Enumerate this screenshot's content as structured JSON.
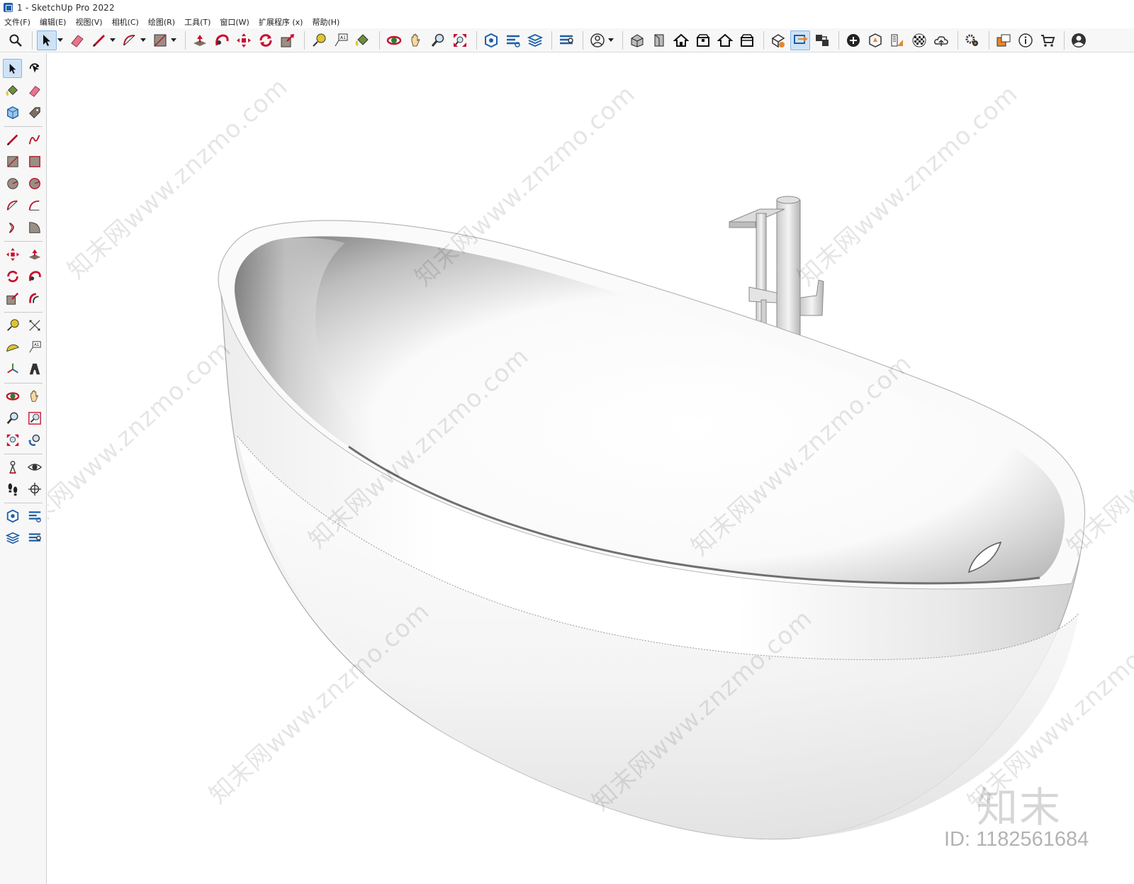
{
  "window": {
    "title": "1 - SketchUp Pro 2022"
  },
  "menu": {
    "items": [
      "文件(F)",
      "编辑(E)",
      "视图(V)",
      "相机(C)",
      "绘图(R)",
      "工具(T)",
      "窗口(W)",
      "扩展程序 (x)",
      "帮助(H)"
    ]
  },
  "toolbar": {
    "icons": [
      "search-icon",
      "select-icon",
      "eraser-icon",
      "pencil-icon",
      "arc-icon",
      "rectangle-icon",
      "push-pull-icon",
      "follow-me-icon",
      "move-icon",
      "rotate-icon",
      "scale-icon",
      "tape-measure-icon",
      "text-icon",
      "paint-bucket-icon",
      "orbit-icon",
      "pan-icon",
      "zoom-icon",
      "zoom-extents-icon",
      "warehouse-icon",
      "extension-warehouse-icon",
      "layout-icon",
      "style-builder-icon",
      "user-icon",
      "iso-view-icon",
      "top-view-icon",
      "front-view-icon",
      "right-view-icon",
      "back-view-icon",
      "left-view-icon",
      "section-plane-icon",
      "section-display-icon",
      "component-icon",
      "add-location-icon",
      "sandbox-icon",
      "photo-texture-icon",
      "preview-icon",
      "cloud-icon",
      "settings-icon",
      "outliner-icon",
      "info-icon",
      "cart-icon",
      "account-icon"
    ],
    "accent": "#1d5fa8",
    "active_tool": "select-icon"
  },
  "left_toolbar": {
    "rows": [
      [
        "select-icon",
        "orbit-icon"
      ],
      [
        "paint-bucket-icon",
        "eraser-icon"
      ],
      [
        "component-icon",
        "tag-icon"
      ],
      [
        "line-icon",
        "freehand-icon"
      ],
      [
        "rectangle-icon",
        "rotated-rectangle-icon"
      ],
      [
        "circle-icon",
        "polygon-icon"
      ],
      [
        "arc-icon",
        "two-point-arc-icon"
      ],
      [
        "three-point-arc-icon",
        "pie-icon"
      ],
      [
        "move-icon",
        "push-pull-icon"
      ],
      [
        "rotate-icon",
        "follow-me-icon"
      ],
      [
        "scale-icon",
        "offset-icon"
      ],
      [
        "tape-measure-icon",
        "dimension-icon"
      ],
      [
        "protractor-icon",
        "text-icon"
      ],
      [
        "axes-icon",
        "3d-text-icon"
      ],
      [
        "orbit-icon",
        "pan-icon"
      ],
      [
        "zoom-icon",
        "zoom-window-icon"
      ],
      [
        "zoom-extents-icon",
        "previous-view-icon"
      ],
      [
        "position-camera-icon",
        "look-around-icon"
      ],
      [
        "walk-icon",
        "section-plane-icon"
      ],
      [
        "warehouse-icon",
        "extension-warehouse-icon"
      ],
      [
        "layout-icon",
        "style-builder-icon"
      ]
    ]
  },
  "viewport": {
    "model": "freestanding-bathtub",
    "watermark_text": "知末网www.znzmo.com"
  },
  "brand": {
    "logo_text": "知末",
    "id_text": "ID: 1182561684"
  }
}
